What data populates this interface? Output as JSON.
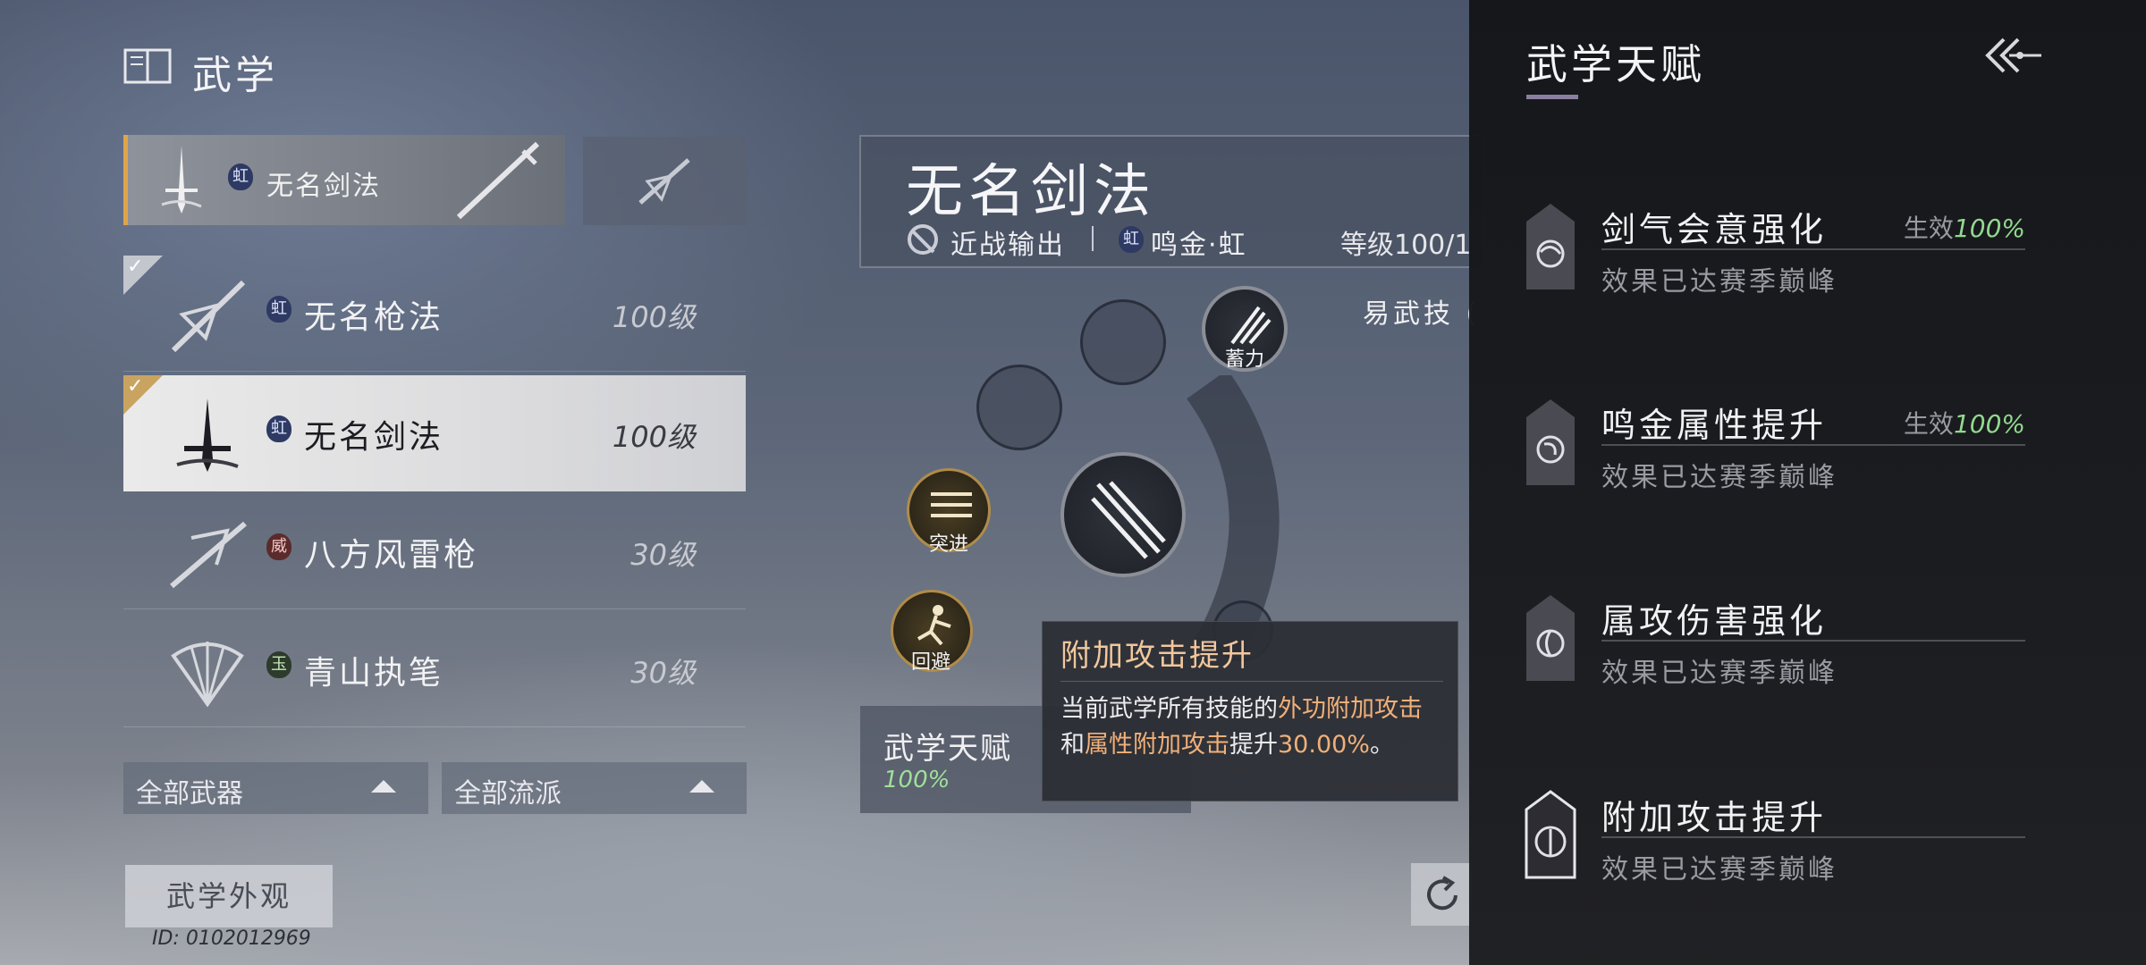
{
  "page": {
    "title": "武学"
  },
  "equipped": {
    "name": "无名剑法",
    "badge": "虹"
  },
  "skills": [
    {
      "name": "无名枪法",
      "badge": "虹",
      "badge_color": "blue",
      "level": "100级",
      "selected": false
    },
    {
      "name": "无名剑法",
      "badge": "虹",
      "badge_color": "blue",
      "level": "100级",
      "selected": true
    },
    {
      "name": "八方风雷枪",
      "badge": "威",
      "badge_color": "red",
      "level": "30级",
      "selected": false
    },
    {
      "name": "青山执笔",
      "badge": "玉",
      "badge_color": "green",
      "level": "30级",
      "selected": false
    }
  ],
  "filters": {
    "weapon": "全部武器",
    "school": "全部流派"
  },
  "appearance_button": "武学外观",
  "player_id": "ID: 0102012969",
  "detail": {
    "name": "无名剑法",
    "role": "近战输出",
    "attr_badge": "虹",
    "attr": "鸣金·虹",
    "level": "等级100/1",
    "easy_skill": "易武技 ("
  },
  "wheel": {
    "charge_label": "蓄力",
    "dash_label": "突进",
    "dodge_label": "回避"
  },
  "talent_box": {
    "label": "武学天赋",
    "value": "100%"
  },
  "tooltip": {
    "title": "附加攻击提升",
    "body_prefix": "当前武学所有技能的",
    "hl1": "外功附加攻击",
    "mid": "和",
    "hl2": "属性附加攻击",
    "body_suffix": "提升",
    "hl3": "30.00%",
    "end": "。"
  },
  "talent_panel": {
    "title": "武学天赋",
    "items": [
      {
        "name": "剑气会意强化",
        "desc": "效果已达赛季巅峰",
        "status_label": "生效",
        "status_value": "100%"
      },
      {
        "name": "鸣金属性提升",
        "desc": "效果已达赛季巅峰",
        "status_label": "生效",
        "status_value": "100%"
      },
      {
        "name": "属攻伤害强化",
        "desc": "效果已达赛季巅峰",
        "status_label": "",
        "status_value": ""
      },
      {
        "name": "附加攻击提升",
        "desc": "效果已达赛季巅峰",
        "status_label": "",
        "status_value": ""
      }
    ]
  },
  "colors": {
    "accent_gold": "#e0a44a",
    "effect_green": "#92d98f",
    "highlight_orange": "#f0b079"
  }
}
